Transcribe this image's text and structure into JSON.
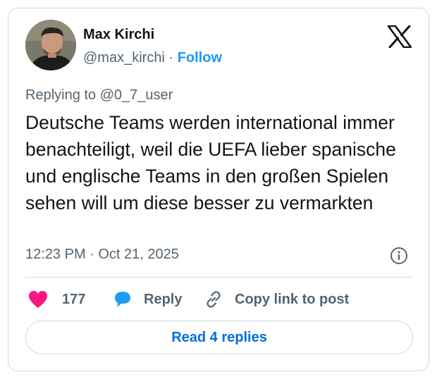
{
  "author": {
    "display_name": "Max Kirchi",
    "handle": "@max_kirchi",
    "separator": "·",
    "follow_label": "Follow",
    "avatar_icon": "user-avatar-photo"
  },
  "brand": {
    "logo_icon": "x-logo"
  },
  "tweet": {
    "replying_to": "Replying to @0_7_user",
    "text": "Deutsche Teams werden international immer benachteiligt, weil die UEFA lieber spanische und englische Teams in den großen Spielen sehen will um diese besser zu vermarkten",
    "timestamp": "12:23 PM · Oct 21, 2025"
  },
  "actions": {
    "like_count": "177",
    "reply_label": "Reply",
    "copy_label": "Copy link to post",
    "read_replies_label": "Read 4 replies"
  },
  "colors": {
    "accent": "#1d9bf0",
    "like": "#f91880",
    "link": "#006fd6",
    "muted": "#536471",
    "border": "#cfd9de"
  }
}
